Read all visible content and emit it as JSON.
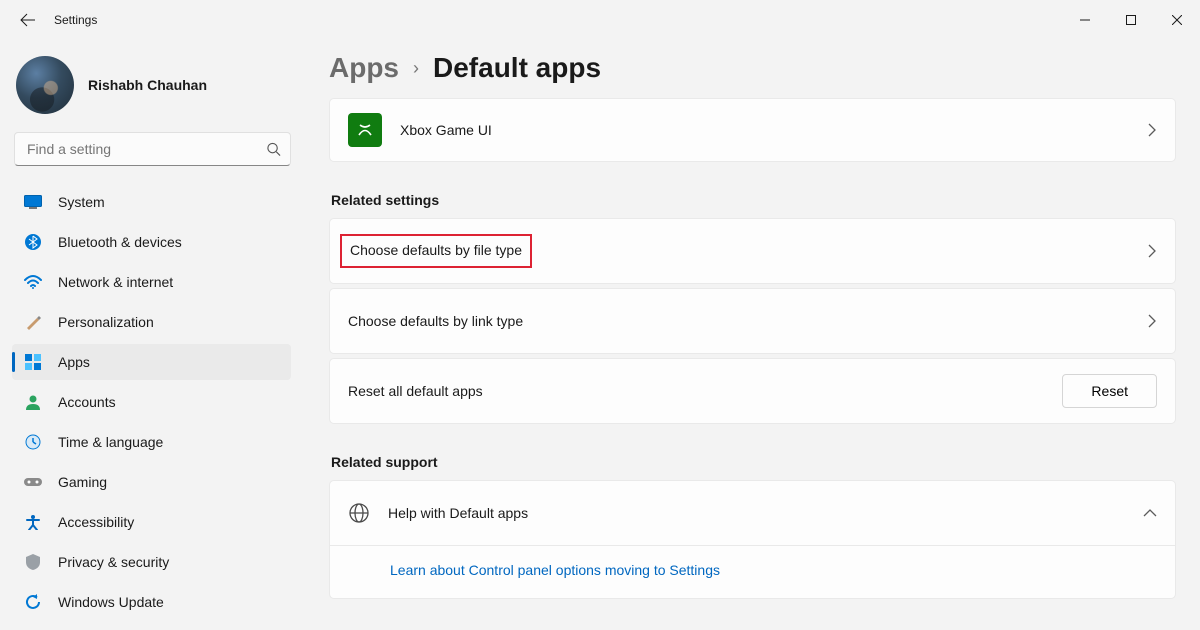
{
  "window": {
    "title": "Settings"
  },
  "profile": {
    "name": "Rishabh Chauhan"
  },
  "search": {
    "placeholder": "Find a setting"
  },
  "nav": [
    {
      "id": "system",
      "label": "System"
    },
    {
      "id": "bluetooth",
      "label": "Bluetooth & devices"
    },
    {
      "id": "network",
      "label": "Network & internet"
    },
    {
      "id": "personalization",
      "label": "Personalization"
    },
    {
      "id": "apps",
      "label": "Apps",
      "active": true
    },
    {
      "id": "accounts",
      "label": "Accounts"
    },
    {
      "id": "time",
      "label": "Time & language"
    },
    {
      "id": "gaming",
      "label": "Gaming"
    },
    {
      "id": "accessibility",
      "label": "Accessibility"
    },
    {
      "id": "privacy",
      "label": "Privacy & security"
    },
    {
      "id": "update",
      "label": "Windows Update"
    }
  ],
  "breadcrumb": {
    "parent": "Apps",
    "current": "Default apps"
  },
  "app_row": {
    "label": "Xbox Game UI"
  },
  "sections": {
    "related_settings": {
      "title": "Related settings",
      "file_type": "Choose defaults by file type",
      "link_type": "Choose defaults by link type",
      "reset_label": "Reset all default apps",
      "reset_button": "Reset"
    },
    "related_support": {
      "title": "Related support",
      "help": "Help with Default apps",
      "link": "Learn about Control panel options moving to Settings"
    }
  }
}
